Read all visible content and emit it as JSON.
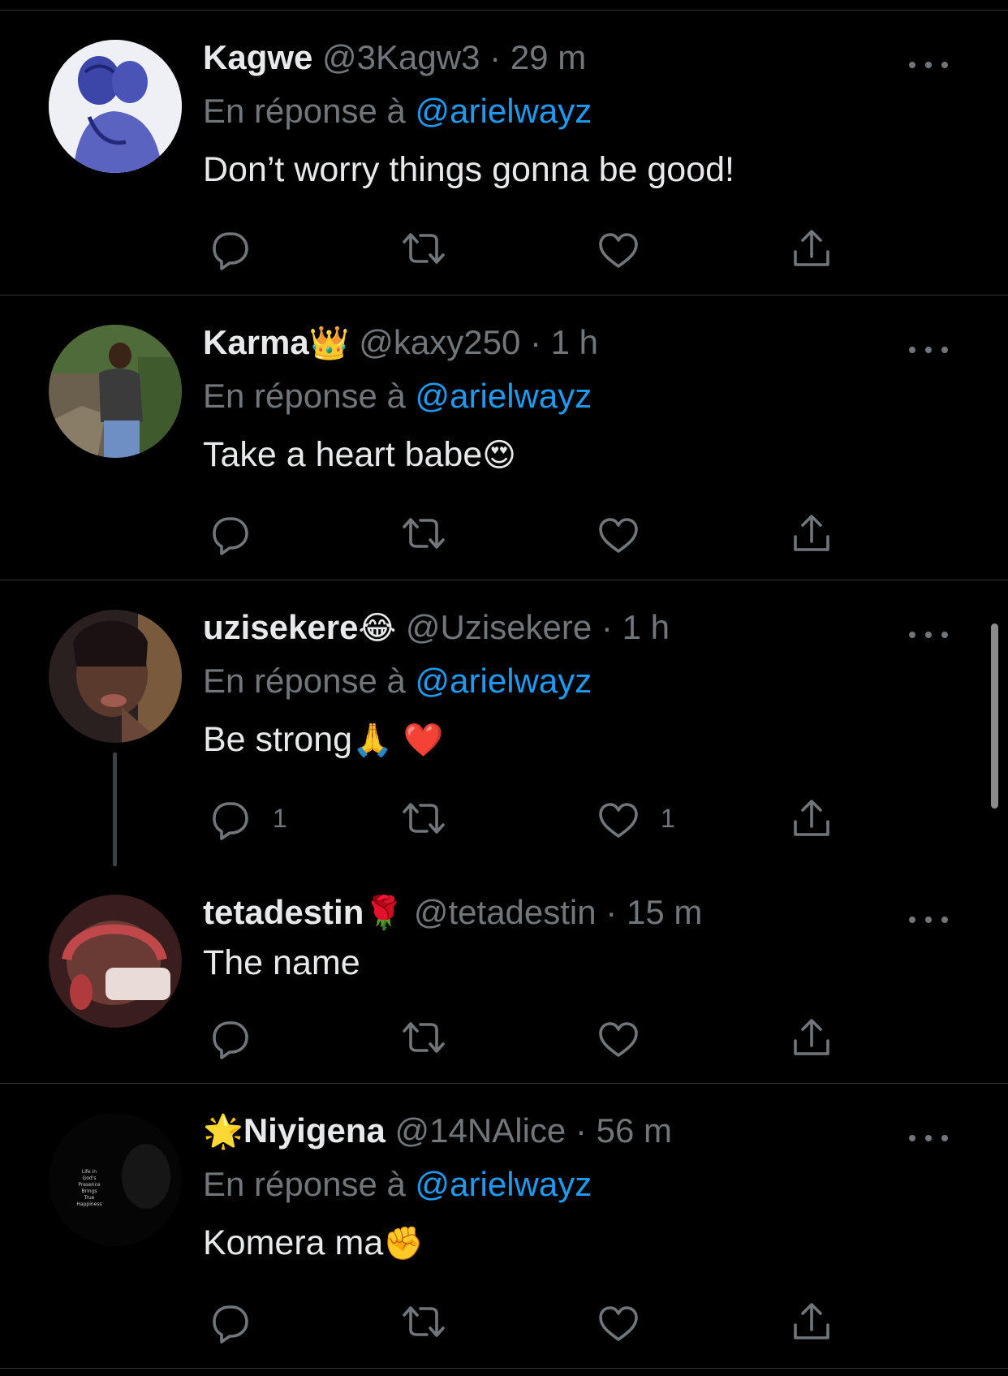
{
  "colors": {
    "background": "#000000",
    "text": "#e7e9ea",
    "muted": "#71767b",
    "link": "#1d9bf0",
    "divider": "#2f3336"
  },
  "tweets": [
    {
      "name": "Kagwe",
      "name_prefix_emoji": "",
      "name_emoji": "",
      "handle": "@3Kagw3",
      "dot": "·",
      "time": "29 m",
      "reply_prefix": "En réponse à",
      "reply_to": "@arielwayz",
      "text": "Don’t worry things gonna be good!",
      "text_emoji": "",
      "reply_count": "",
      "like_count": "",
      "avatar_icon": "avatar-drawing"
    },
    {
      "name": "Karma",
      "name_prefix_emoji": "",
      "name_emoji": "👑",
      "handle": "@kaxy250",
      "dot": "·",
      "time": "1 h",
      "reply_prefix": "En réponse à",
      "reply_to": "@arielwayz",
      "text": "Take a heart babe",
      "text_emoji": "😍",
      "reply_count": "",
      "like_count": "",
      "avatar_icon": "avatar-photo"
    },
    {
      "name": "uzisekere",
      "name_prefix_emoji": "",
      "name_emoji": "😂",
      "handle": "@Uzisekere",
      "dot": "·",
      "time": "1 h",
      "reply_prefix": "En réponse à",
      "reply_to": "@arielwayz",
      "text": "Be strong",
      "text_emoji": "🙏 ❤️",
      "reply_count": "1",
      "like_count": "1",
      "avatar_icon": "avatar-photo"
    },
    {
      "name": "tetadestin",
      "name_prefix_emoji": "",
      "name_emoji": "🌹",
      "handle": "@tetadestin",
      "dot": "·",
      "time": "15 m",
      "reply_prefix": "",
      "reply_to": "",
      "text": "The name",
      "text_emoji": "",
      "reply_count": "",
      "like_count": "",
      "avatar_icon": "avatar-photo"
    },
    {
      "name": "Niyigena",
      "name_prefix_emoji": "🌟",
      "name_emoji": "",
      "handle": "@14NAlice",
      "dot": "·",
      "time": "56 m",
      "reply_prefix": "En réponse à",
      "reply_to": "@arielwayz",
      "text": "Komera ma",
      "text_emoji": "✊",
      "reply_count": "",
      "like_count": "",
      "avatar_icon": "avatar-dark-quote",
      "avatar_text": "Life in God's Presence Brings True Happiness"
    }
  ]
}
